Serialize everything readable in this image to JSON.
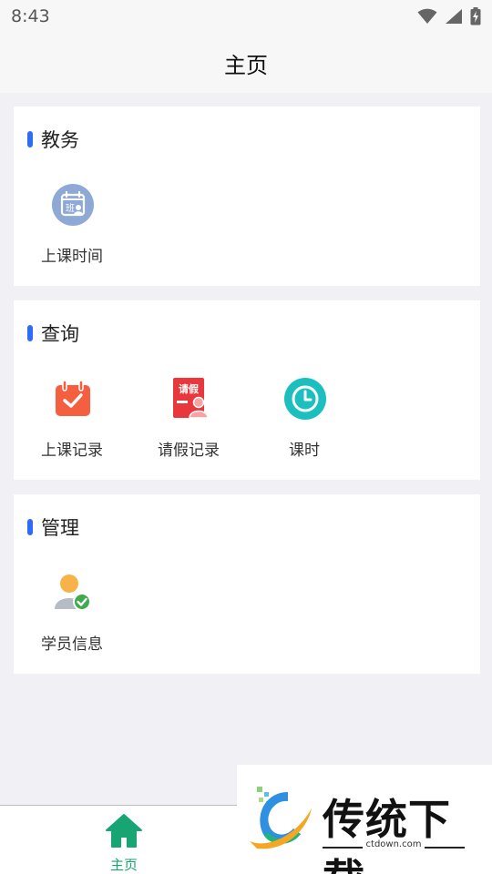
{
  "status_bar": {
    "time": "8:43"
  },
  "app_bar": {
    "title": "主页"
  },
  "sections": [
    {
      "title": "教务",
      "items": [
        {
          "label": "上课时间",
          "icon": "class-schedule-icon"
        }
      ]
    },
    {
      "title": "查询",
      "items": [
        {
          "label": "上课记录",
          "icon": "calendar-check-icon"
        },
        {
          "label": "请假记录",
          "icon": "leave-request-icon",
          "icon_text": "请假"
        },
        {
          "label": "课时",
          "icon": "clock-icon"
        }
      ]
    },
    {
      "title": "管理",
      "items": [
        {
          "label": "学员信息",
          "icon": "student-verified-icon"
        }
      ]
    }
  ],
  "bottom_nav": {
    "items": [
      {
        "label": "主页",
        "icon": "home-icon",
        "active": true
      }
    ]
  },
  "schedule_icon_text": "班",
  "watermark": {
    "brand": "传统下载",
    "url": "ctdown.com"
  },
  "colors": {
    "accent_bar": "#2f6cf6",
    "nav_active": "#17a673",
    "schedule_icon": "#8fa9d6",
    "calendar_icon": "#f35f3f",
    "leave_icon": "#e8383d",
    "clock_icon": "#1bbfbd",
    "student_icon_head": "#f7b34a",
    "student_icon_check": "#3faa4f"
  }
}
